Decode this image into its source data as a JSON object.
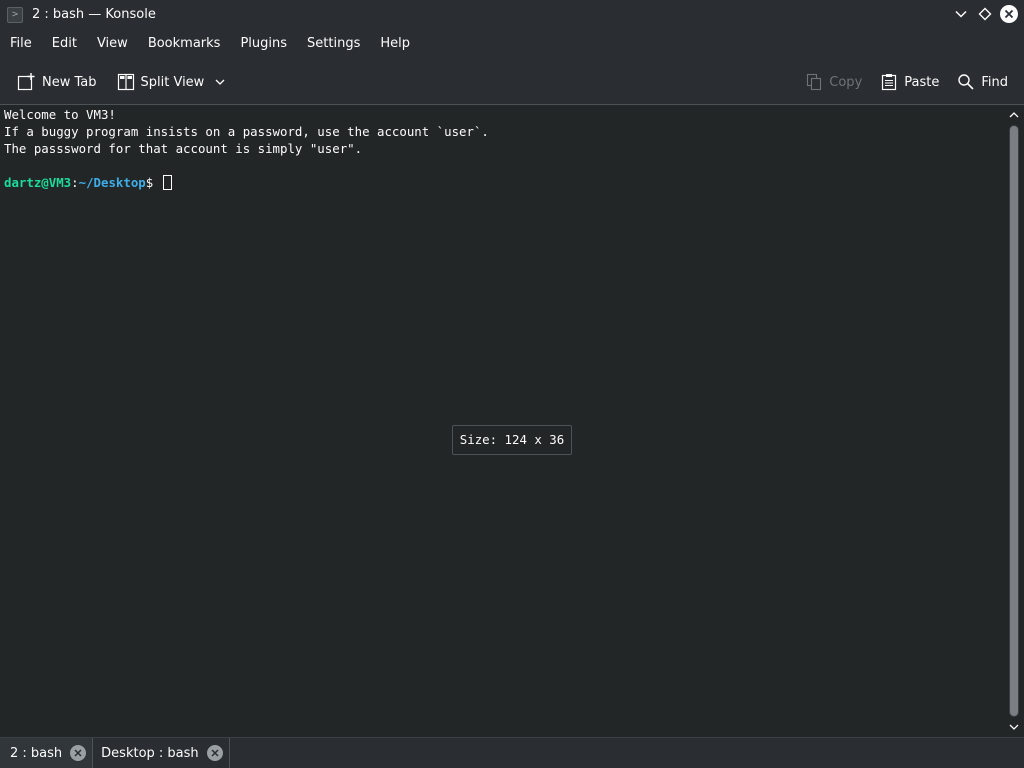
{
  "window": {
    "title": "2 : bash — Konsole"
  },
  "menu": {
    "items": [
      "File",
      "Edit",
      "View",
      "Bookmarks",
      "Plugins",
      "Settings",
      "Help"
    ]
  },
  "toolbar": {
    "new_tab": "New Tab",
    "split_view": "Split View",
    "copy": "Copy",
    "paste": "Paste",
    "find": "Find"
  },
  "terminal": {
    "lines": [
      "Welcome to VM3!",
      "If a buggy program insists on a password, use the account `user`.",
      "The passsword for that account is simply \"user\"."
    ],
    "prompt": {
      "user_host": "dartz@VM3",
      "sep": ":",
      "path": "~/Desktop",
      "symbol": "$ "
    }
  },
  "tooltip": {
    "size_text": "Size: 124 x 36"
  },
  "tabs": [
    {
      "label": "2 : bash",
      "active": false
    },
    {
      "label": "Desktop : bash",
      "active": true
    }
  ],
  "colors": {
    "window_bg": "#2a2e32",
    "terminal_bg": "#232627",
    "prompt_user": "#1cdc9a",
    "prompt_path": "#3daee9",
    "text": "#fcfcfc"
  },
  "icons": {
    "app": "terminal-app-icon",
    "minimize": "chevron-down-icon",
    "maximize": "diamond-icon",
    "close": "close-icon",
    "new_tab": "new-tab-icon",
    "split_view": "split-view-icon",
    "copy": "copy-icon",
    "paste": "paste-icon",
    "find": "search-icon"
  }
}
